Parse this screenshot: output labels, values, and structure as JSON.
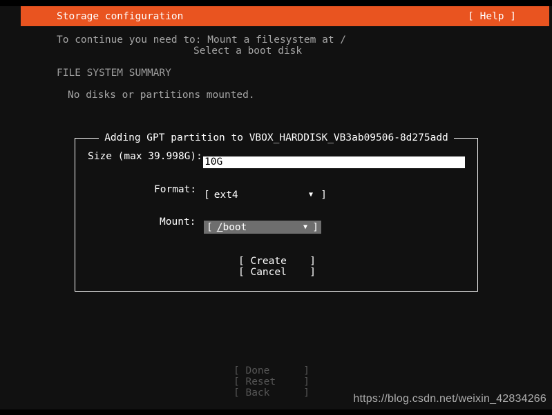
{
  "screen": {
    "background_color": "#111111",
    "foreground_color": "#ffffff",
    "accent_color": "#e95420"
  },
  "header": {
    "title": "Storage configuration",
    "help_label": "[ Help ]"
  },
  "body": {
    "continue_line1": "To continue you need to: Mount a filesystem at /",
    "continue_line2": "Select a boot disk",
    "fs_summary_heading": "FILE SYSTEM SUMMARY",
    "fs_summary_text": "No disks or partitions mounted."
  },
  "dialog": {
    "title": "Adding GPT partition to VBOX_HARDDISK_VB3ab09506-8d275add",
    "size": {
      "label": "Size (max 39.998G):",
      "value": "10G",
      "placeholder": ""
    },
    "format": {
      "label": "Format:",
      "bracket_left": "[",
      "value": "ext4",
      "caret": "▼",
      "bracket_right": "]",
      "selected": false
    },
    "mount": {
      "label": "Mount:",
      "bracket_left": "[",
      "value_slash": "/",
      "value_rest": "boot",
      "caret": "▼",
      "bracket_right": "]",
      "selected": true,
      "highlight_color": "#6e6e6e"
    },
    "buttons": [
      {
        "bracket_left": "[ Create",
        "bracket_right": "]"
      },
      {
        "bracket_left": "[ Cancel",
        "bracket_right": "]"
      }
    ]
  },
  "footer": {
    "buttons": [
      {
        "bracket_left": "[ Done",
        "bracket_right": "]"
      },
      {
        "bracket_left": "[ Reset",
        "bracket_right": "]"
      },
      {
        "bracket_left": "[ Back",
        "bracket_right": "]"
      }
    ],
    "disabled_color": "#555555"
  },
  "watermark": {
    "text": "https://blog.csdn.net/weixin_42834266"
  }
}
